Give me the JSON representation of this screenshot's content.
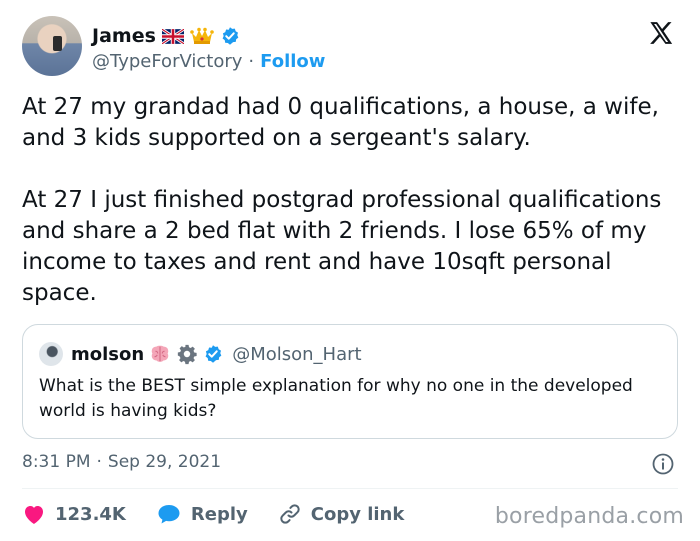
{
  "author": {
    "name": "James",
    "handle": "@TypeForVictory",
    "separator": "·",
    "follow_label": "Follow",
    "badges": [
      "uk-flag-icon",
      "crown-icon",
      "verified-badge-icon"
    ]
  },
  "tweet": {
    "paragraphs": [
      "At 27 my grandad had 0 qualifications, a house, a wife, and 3 kids supported on a sergeant's salary.",
      "At 27 I just finished postgrad professional qualifications and share a 2 bed flat with 2 friends. I lose 65% of my income to taxes and rent and have 10sqft personal space."
    ]
  },
  "quote": {
    "name": "molson",
    "handle": "@Molson_Hart",
    "text": "What is the BEST simple explanation for why no one in the developed world is having kids?"
  },
  "meta": {
    "time": "8:31 PM",
    "separator": "·",
    "date": "Sep 29, 2021"
  },
  "actions": {
    "likes": "123.4K",
    "reply_label": "Reply",
    "copy_link_label": "Copy link"
  },
  "watermark": "boredpanda.com",
  "colors": {
    "accent": "#1d9bf0",
    "like": "#f91880",
    "text": "#0f1419",
    "secondary": "#536471",
    "border": "#cfd9de"
  }
}
